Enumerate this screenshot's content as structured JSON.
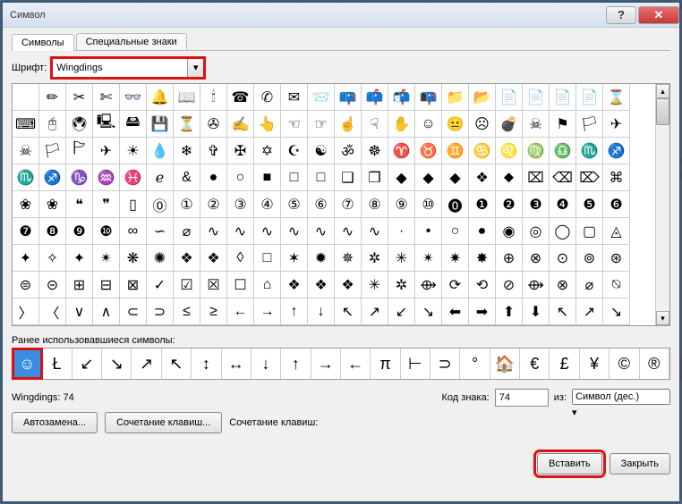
{
  "window": {
    "title": "Символ"
  },
  "tabs": {
    "symbols": "Символы",
    "special": "Специальные знаки"
  },
  "fontRow": {
    "label": "Шрифт:",
    "value": "Wingdings"
  },
  "recentLabel": "Ранее использовавшиеся символы:",
  "recent": [
    "☺",
    "Ł",
    "↙",
    "↘",
    "↗",
    "↖",
    "↕",
    "↔",
    "↓",
    "↑",
    "→",
    "←",
    "π",
    "⊢",
    "⊃",
    "°",
    "🏠",
    "€",
    "£",
    "¥",
    "©",
    "®"
  ],
  "status": {
    "name": "Wingdings: 74"
  },
  "codeRow": {
    "codeLabel": "Код знака:",
    "codeValue": "74",
    "fromLabel": "из:",
    "fromValue": "Символ (дес.)"
  },
  "actions": {
    "autocorrect": "Автозамена...",
    "shortcut": "Сочетание клавиш...",
    "shortcutLabel": "Сочетание клавиш:"
  },
  "footer": {
    "insert": "Вставить",
    "close": "Закрыть"
  },
  "grid": [
    "",
    "✏",
    "✂",
    "✄",
    "👓",
    "🔔",
    "📖",
    "🕯",
    "☎",
    "✆",
    "✉",
    "📨",
    "📪",
    "📫",
    "📬",
    "📭",
    "📁",
    "📂",
    "📄",
    "📄",
    "📄",
    "📄",
    "⌛",
    "⌨",
    "🖰",
    "🖲",
    "🖳",
    "🖴",
    "💾",
    "⏳",
    "✇",
    "✍",
    "👆",
    "☜",
    "☞",
    "☝",
    "☟",
    "✋",
    "☺",
    "😐",
    "☹",
    "💣",
    "☠",
    "⚑",
    "🏳",
    "✈",
    "☠",
    "🏳",
    "🏱",
    "✈",
    "☀",
    "💧",
    "❄",
    "✞",
    "✠",
    "✡",
    "☪",
    "☯",
    "ॐ",
    "☸",
    "♈",
    "♉",
    "♊",
    "♋",
    "♌",
    "♍",
    "♎",
    "♏",
    "♐",
    "♏",
    "♐",
    "♑",
    "♒",
    "♓",
    "ℯ",
    "&",
    "●",
    "○",
    "■",
    "□",
    "□",
    "❑",
    "❒",
    "◆",
    "◆",
    "◆",
    "❖",
    "⬥",
    "⌧",
    "⌫",
    "⌦",
    "⌘",
    "❀",
    "❀",
    "❝",
    "❞",
    "▯",
    "⓪",
    "①",
    "②",
    "③",
    "④",
    "⑤",
    "⑥",
    "⑦",
    "⑧",
    "⑨",
    "⑩",
    "⓿",
    "❶",
    "❷",
    "❸",
    "❹",
    "❺",
    "❻",
    "❼",
    "❽",
    "❾",
    "❿",
    "∞",
    "∽",
    "⌀",
    "∿",
    "∿",
    "∿",
    "∿",
    "∿",
    "∿",
    "∿",
    "·",
    "•",
    "○",
    "●",
    "◉",
    "◎",
    "◯",
    "▢",
    "◬",
    "✦",
    "✧",
    "✦",
    "✴",
    "❋",
    "✺",
    "❖",
    "❖",
    "◊",
    "□",
    "✶",
    "✹",
    "✵",
    "✲",
    "✳",
    "✴",
    "✷",
    "✸",
    "⊕",
    "⊗",
    "⊙",
    "⊚",
    "⊛",
    "⊜",
    "⊝",
    "⊞",
    "⊟",
    "⊠",
    "✓",
    "☑",
    "☒",
    "☐",
    "⌂",
    "❖",
    "❖",
    "❖",
    "✳",
    "✲",
    "⟴",
    "⟳",
    "⟲",
    "⊘",
    "⟴",
    "⊗",
    "⌀",
    "⍉",
    "〉",
    "〈",
    "∨",
    "∧",
    "⊂",
    "⊃",
    "≤",
    "≥",
    "←",
    "→",
    "↑",
    "↓",
    "↖",
    "↗",
    "↙",
    "↘",
    "⬅",
    "➡",
    "⬆",
    "⬇",
    "↖",
    "↗",
    "↘"
  ]
}
